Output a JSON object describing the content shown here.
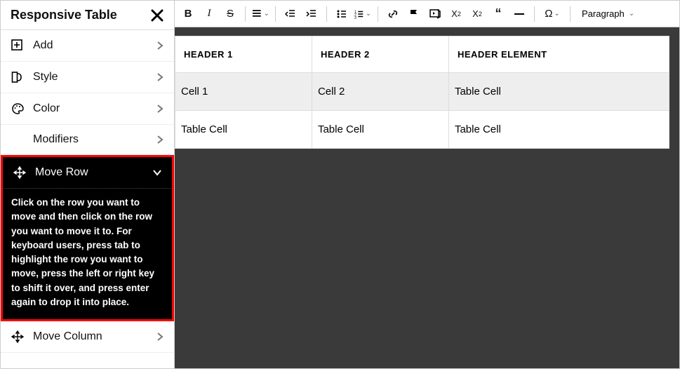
{
  "sidebar": {
    "title": "Responsive Table",
    "items": [
      {
        "label": "Add"
      },
      {
        "label": "Style"
      },
      {
        "label": "Color"
      },
      {
        "label": "Modifiers",
        "sub": true
      },
      {
        "label": "Move Row",
        "expanded": true,
        "help": "Click on the row you want to move and then click on the row you want to move it to. For keyboard users, press tab to highlight the row you want to move, press the left or right key to shift it over, and press enter again to drop it into place."
      },
      {
        "label": "Move Column"
      }
    ]
  },
  "toolbar": {
    "paragraph_label": "Paragraph"
  },
  "table": {
    "headers": [
      "Header 1",
      "Header 2",
      "Header Element"
    ],
    "rows": [
      [
        "Cell 1",
        "Cell 2",
        "Table Cell"
      ],
      [
        "Table Cell",
        "Table Cell",
        "Table Cell"
      ]
    ]
  }
}
